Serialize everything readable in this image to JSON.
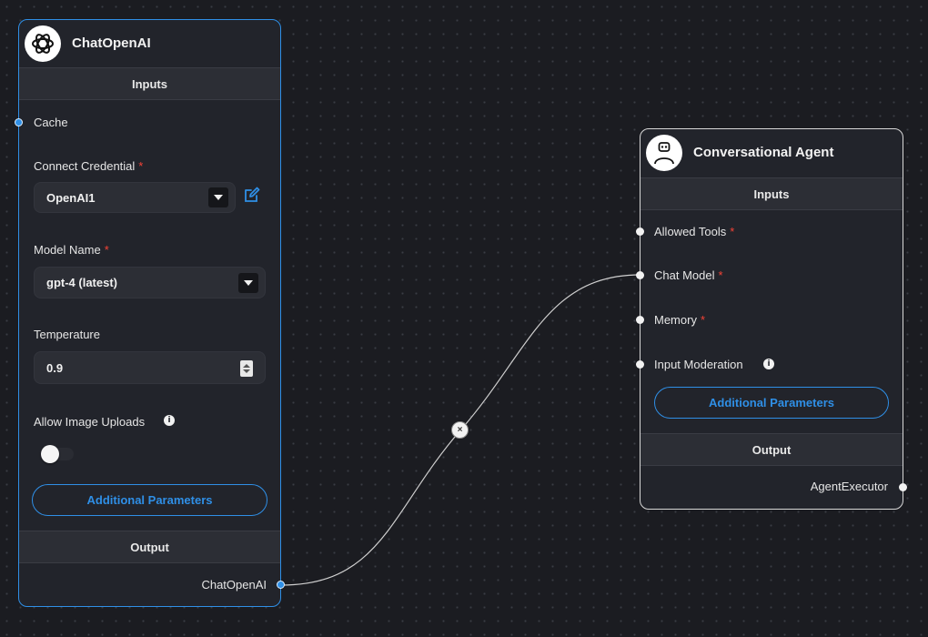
{
  "chat_openai": {
    "title": "ChatOpenAI",
    "inputs_label": "Inputs",
    "cache_label": "Cache",
    "credential_label": "Connect Credential",
    "credential_value": "OpenAI1",
    "model_label": "Model Name",
    "model_value": "gpt-4 (latest)",
    "temperature_label": "Temperature",
    "temperature_value": "0.9",
    "image_uploads_label": "Allow Image Uploads",
    "image_uploads_enabled": false,
    "additional_params_label": "Additional Parameters",
    "output_label": "Output",
    "output_name": "ChatOpenAI",
    "required_mark": "*"
  },
  "agent": {
    "title": "Conversational Agent",
    "inputs_label": "Inputs",
    "allowed_tools_label": "Allowed Tools",
    "chat_model_label": "Chat Model",
    "memory_label": "Memory",
    "input_moderation_label": "Input Moderation",
    "additional_params_label": "Additional Parameters",
    "output_label": "Output",
    "output_name": "AgentExecutor",
    "required_mark": "*"
  },
  "edge": {
    "delete_glyph": "×"
  },
  "colors": {
    "accent": "#2f8fe6",
    "required": "#f44336",
    "canvas": "#1b1c21",
    "node": "#22242b"
  }
}
